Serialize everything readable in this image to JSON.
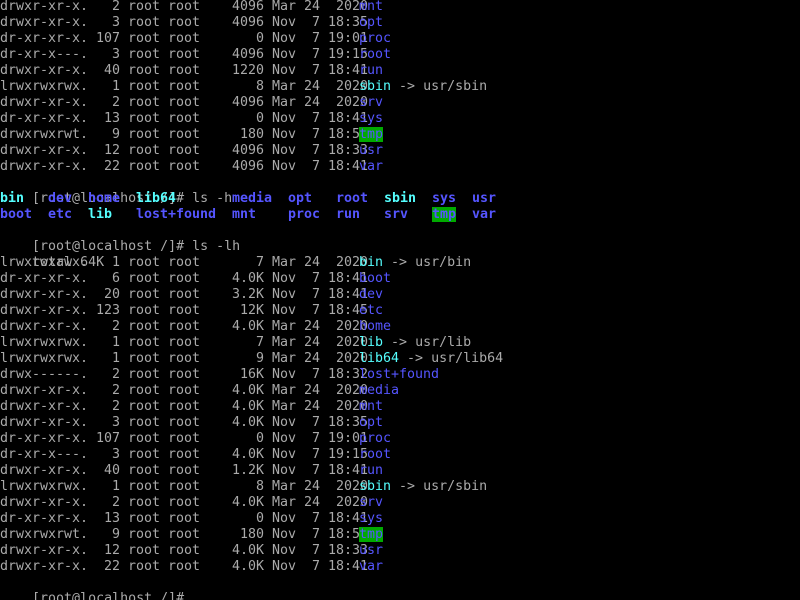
{
  "colors": {
    "background": "#000000",
    "text": "#aaaaaa",
    "directory": "#5555ff",
    "symlink": "#55ffff",
    "sticky_dir_bg": "#00aa00"
  },
  "top_listing": [
    {
      "perm": "drwxr-xr-x.",
      "links": "2",
      "owner": "root",
      "group": "root",
      "size": "4096",
      "mon": "Mar",
      "day": "24",
      "time": "2020",
      "name": "mnt",
      "kind": "dir"
    },
    {
      "perm": "drwxr-xr-x.",
      "links": "3",
      "owner": "root",
      "group": "root",
      "size": "4096",
      "mon": "Nov",
      "day": "7",
      "time": "18:35",
      "name": "opt",
      "kind": "dir"
    },
    {
      "perm": "dr-xr-xr-x.",
      "links": "107",
      "owner": "root",
      "group": "root",
      "size": "0",
      "mon": "Nov",
      "day": "7",
      "time": "19:01",
      "name": "proc",
      "kind": "dir"
    },
    {
      "perm": "dr-xr-x---.",
      "links": "3",
      "owner": "root",
      "group": "root",
      "size": "4096",
      "mon": "Nov",
      "day": "7",
      "time": "19:15",
      "name": "root",
      "kind": "dir"
    },
    {
      "perm": "drwxr-xr-x.",
      "links": "40",
      "owner": "root",
      "group": "root",
      "size": "1220",
      "mon": "Nov",
      "day": "7",
      "time": "18:41",
      "name": "run",
      "kind": "dir"
    },
    {
      "perm": "lrwxrwxrwx.",
      "links": "1",
      "owner": "root",
      "group": "root",
      "size": "8",
      "mon": "Mar",
      "day": "24",
      "time": "2020",
      "name": "sbin",
      "kind": "link",
      "target": "usr/sbin"
    },
    {
      "perm": "drwxr-xr-x.",
      "links": "2",
      "owner": "root",
      "group": "root",
      "size": "4096",
      "mon": "Mar",
      "day": "24",
      "time": "2020",
      "name": "srv",
      "kind": "dir"
    },
    {
      "perm": "dr-xr-xr-x.",
      "links": "13",
      "owner": "root",
      "group": "root",
      "size": "0",
      "mon": "Nov",
      "day": "7",
      "time": "18:41",
      "name": "sys",
      "kind": "dir"
    },
    {
      "perm": "drwxrwxrwt.",
      "links": "9",
      "owner": "root",
      "group": "root",
      "size": "180",
      "mon": "Nov",
      "day": "7",
      "time": "18:58",
      "name": "tmp",
      "kind": "sticky"
    },
    {
      "perm": "drwxr-xr-x.",
      "links": "12",
      "owner": "root",
      "group": "root",
      "size": "4096",
      "mon": "Nov",
      "day": "7",
      "time": "18:33",
      "name": "usr",
      "kind": "dir"
    },
    {
      "perm": "drwxr-xr-x.",
      "links": "22",
      "owner": "root",
      "group": "root",
      "size": "4096",
      "mon": "Nov",
      "day": "7",
      "time": "18:41",
      "name": "var",
      "kind": "dir"
    }
  ],
  "prompt1": "[root@localhost /]# ls -h",
  "short_listing": {
    "row1": [
      {
        "name": "bin",
        "kind": "link"
      },
      {
        "name": "dev",
        "kind": "dir"
      },
      {
        "name": "home",
        "kind": "dir"
      },
      {
        "name": "lib64",
        "kind": "link"
      },
      {
        "name": "media",
        "kind": "dir"
      },
      {
        "name": "opt",
        "kind": "dir"
      },
      {
        "name": "root",
        "kind": "dir"
      },
      {
        "name": "sbin",
        "kind": "link"
      },
      {
        "name": "sys",
        "kind": "dir"
      },
      {
        "name": "usr",
        "kind": "dir"
      }
    ],
    "row2": [
      {
        "name": "boot",
        "kind": "dir"
      },
      {
        "name": "etc",
        "kind": "dir"
      },
      {
        "name": "lib",
        "kind": "link"
      },
      {
        "name": "lost+found",
        "kind": "dir"
      },
      {
        "name": "mnt",
        "kind": "dir"
      },
      {
        "name": "proc",
        "kind": "dir"
      },
      {
        "name": "run",
        "kind": "dir"
      },
      {
        "name": "srv",
        "kind": "dir"
      },
      {
        "name": "tmp",
        "kind": "sticky"
      },
      {
        "name": "var",
        "kind": "dir"
      }
    ]
  },
  "prompt2": "[root@localhost /]# ls -lh",
  "total": "total 64K",
  "long_listing": [
    {
      "perm": "lrwxrwxrwx.",
      "links": "1",
      "owner": "root",
      "group": "root",
      "size": "7",
      "mon": "Mar",
      "day": "24",
      "time": "2020",
      "name": "bin",
      "kind": "link",
      "target": "usr/bin"
    },
    {
      "perm": "dr-xr-xr-x.",
      "links": "6",
      "owner": "root",
      "group": "root",
      "size": "4.0K",
      "mon": "Nov",
      "day": "7",
      "time": "18:41",
      "name": "boot",
      "kind": "dir"
    },
    {
      "perm": "drwxr-xr-x.",
      "links": "20",
      "owner": "root",
      "group": "root",
      "size": "3.2K",
      "mon": "Nov",
      "day": "7",
      "time": "18:41",
      "name": "dev",
      "kind": "dir"
    },
    {
      "perm": "drwxr-xr-x.",
      "links": "123",
      "owner": "root",
      "group": "root",
      "size": "12K",
      "mon": "Nov",
      "day": "7",
      "time": "18:45",
      "name": "etc",
      "kind": "dir"
    },
    {
      "perm": "drwxr-xr-x.",
      "links": "2",
      "owner": "root",
      "group": "root",
      "size": "4.0K",
      "mon": "Mar",
      "day": "24",
      "time": "2020",
      "name": "home",
      "kind": "dir"
    },
    {
      "perm": "lrwxrwxrwx.",
      "links": "1",
      "owner": "root",
      "group": "root",
      "size": "7",
      "mon": "Mar",
      "day": "24",
      "time": "2020",
      "name": "lib",
      "kind": "link",
      "target": "usr/lib"
    },
    {
      "perm": "lrwxrwxrwx.",
      "links": "1",
      "owner": "root",
      "group": "root",
      "size": "9",
      "mon": "Mar",
      "day": "24",
      "time": "2020",
      "name": "lib64",
      "kind": "link",
      "target": "usr/lib64"
    },
    {
      "perm": "drwx------.",
      "links": "2",
      "owner": "root",
      "group": "root",
      "size": "16K",
      "mon": "Nov",
      "day": "7",
      "time": "18:32",
      "name": "lost+found",
      "kind": "dir"
    },
    {
      "perm": "drwxr-xr-x.",
      "links": "2",
      "owner": "root",
      "group": "root",
      "size": "4.0K",
      "mon": "Mar",
      "day": "24",
      "time": "2020",
      "name": "media",
      "kind": "dir"
    },
    {
      "perm": "drwxr-xr-x.",
      "links": "2",
      "owner": "root",
      "group": "root",
      "size": "4.0K",
      "mon": "Mar",
      "day": "24",
      "time": "2020",
      "name": "mnt",
      "kind": "dir"
    },
    {
      "perm": "drwxr-xr-x.",
      "links": "3",
      "owner": "root",
      "group": "root",
      "size": "4.0K",
      "mon": "Nov",
      "day": "7",
      "time": "18:35",
      "name": "opt",
      "kind": "dir"
    },
    {
      "perm": "dr-xr-xr-x.",
      "links": "107",
      "owner": "root",
      "group": "root",
      "size": "0",
      "mon": "Nov",
      "day": "7",
      "time": "19:01",
      "name": "proc",
      "kind": "dir"
    },
    {
      "perm": "dr-xr-x---.",
      "links": "3",
      "owner": "root",
      "group": "root",
      "size": "4.0K",
      "mon": "Nov",
      "day": "7",
      "time": "19:15",
      "name": "root",
      "kind": "dir"
    },
    {
      "perm": "drwxr-xr-x.",
      "links": "40",
      "owner": "root",
      "group": "root",
      "size": "1.2K",
      "mon": "Nov",
      "day": "7",
      "time": "18:41",
      "name": "run",
      "kind": "dir"
    },
    {
      "perm": "lrwxrwxrwx.",
      "links": "1",
      "owner": "root",
      "group": "root",
      "size": "8",
      "mon": "Mar",
      "day": "24",
      "time": "2020",
      "name": "sbin",
      "kind": "link",
      "target": "usr/sbin"
    },
    {
      "perm": "drwxr-xr-x.",
      "links": "2",
      "owner": "root",
      "group": "root",
      "size": "4.0K",
      "mon": "Mar",
      "day": "24",
      "time": "2020",
      "name": "srv",
      "kind": "dir"
    },
    {
      "perm": "dr-xr-xr-x.",
      "links": "13",
      "owner": "root",
      "group": "root",
      "size": "0",
      "mon": "Nov",
      "day": "7",
      "time": "18:41",
      "name": "sys",
      "kind": "dir"
    },
    {
      "perm": "drwxrwxrwt.",
      "links": "9",
      "owner": "root",
      "group": "root",
      "size": "180",
      "mon": "Nov",
      "day": "7",
      "time": "18:58",
      "name": "tmp",
      "kind": "sticky"
    },
    {
      "perm": "drwxr-xr-x.",
      "links": "12",
      "owner": "root",
      "group": "root",
      "size": "4.0K",
      "mon": "Nov",
      "day": "7",
      "time": "18:33",
      "name": "usr",
      "kind": "dir"
    },
    {
      "perm": "drwxr-xr-x.",
      "links": "22",
      "owner": "root",
      "group": "root",
      "size": "4.0K",
      "mon": "Nov",
      "day": "7",
      "time": "18:41",
      "name": "var",
      "kind": "dir"
    }
  ],
  "prompt3": "[root@localhost /]#"
}
